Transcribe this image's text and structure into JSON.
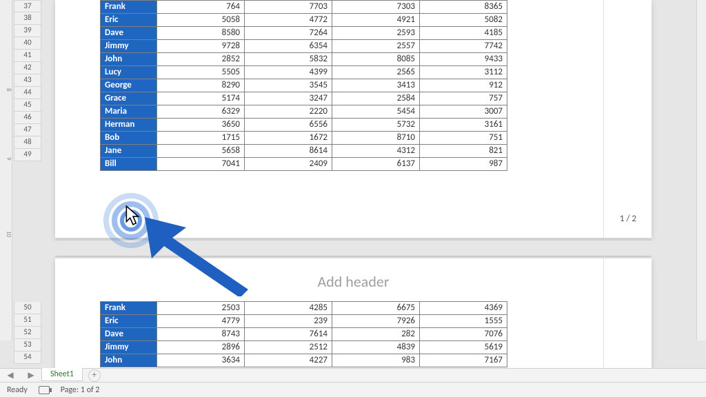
{
  "sheet_tab": "Sheet1",
  "status": {
    "ready": "Ready",
    "page_of": "Page: 1 of 2"
  },
  "page_number": "1 / 2",
  "add_header_placeholder": "Add header",
  "row_numbers_top": [
    "37",
    "38",
    "39",
    "40",
    "41",
    "42",
    "43",
    "44",
    "45",
    "46",
    "47",
    "48",
    "49"
  ],
  "row_numbers_bottom": [
    "50",
    "51",
    "52",
    "53",
    "54"
  ],
  "ruler_marks": [
    {
      "label": "8"
    },
    {
      "label": "9"
    },
    {
      "label": "10"
    }
  ],
  "table1": [
    {
      "name": "Frank",
      "v": [
        764,
        7703,
        7303,
        8365
      ]
    },
    {
      "name": "Eric",
      "v": [
        5058,
        4772,
        4921,
        5082
      ]
    },
    {
      "name": "Dave",
      "v": [
        8580,
        7264,
        2593,
        4185
      ]
    },
    {
      "name": "Jimmy",
      "v": [
        9728,
        6354,
        2557,
        7742
      ]
    },
    {
      "name": "John",
      "v": [
        2852,
        5832,
        8085,
        9433
      ]
    },
    {
      "name": "Lucy",
      "v": [
        5505,
        4399,
        2565,
        3112
      ]
    },
    {
      "name": "George",
      "v": [
        8290,
        3545,
        3413,
        912
      ]
    },
    {
      "name": "Grace",
      "v": [
        5174,
        3247,
        2584,
        757
      ]
    },
    {
      "name": "Maria",
      "v": [
        6329,
        2220,
        5454,
        3007
      ]
    },
    {
      "name": "Herman",
      "v": [
        3650,
        6556,
        5732,
        3161
      ]
    },
    {
      "name": "Bob",
      "v": [
        1715,
        1672,
        8710,
        751
      ]
    },
    {
      "name": "Jane",
      "v": [
        5658,
        8614,
        4312,
        821
      ]
    },
    {
      "name": "Bill",
      "v": [
        7041,
        2409,
        6137,
        987
      ]
    }
  ],
  "table2": [
    {
      "name": "Frank",
      "v": [
        2503,
        4285,
        6675,
        4369
      ]
    },
    {
      "name": "Eric",
      "v": [
        4779,
        239,
        7926,
        1555
      ]
    },
    {
      "name": "Dave",
      "v": [
        8743,
        7614,
        282,
        7076
      ]
    },
    {
      "name": "Jimmy",
      "v": [
        2896,
        2512,
        4839,
        5619
      ]
    },
    {
      "name": "John",
      "v": [
        3634,
        4227,
        983,
        7167
      ]
    }
  ]
}
